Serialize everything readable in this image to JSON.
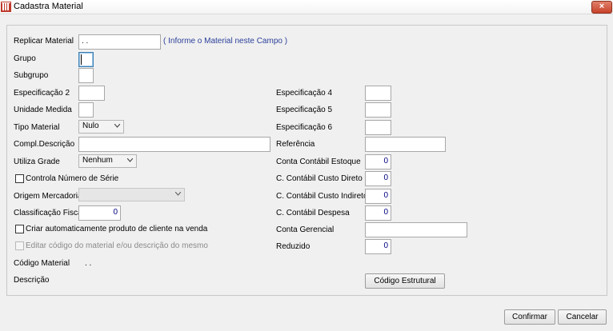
{
  "window": {
    "title": "Cadastra Material",
    "close_label": "×"
  },
  "left": {
    "replicar_label": "Replicar Material",
    "replicar_value": ".  .",
    "replicar_hint": "( Informe o Material neste Campo )",
    "grupo_label": "Grupo",
    "subgrupo_label": "Subgrupo",
    "espec2_label": "Especificação 2",
    "unidade_label": "Unidade Medida",
    "tipo_label": "Tipo Material",
    "tipo_value": "Nulo",
    "compl_label": "Compl.Descrição",
    "grade_label": "Utiliza Grade",
    "grade_value": "Nenhum",
    "serie_label": "Controla Número de Série",
    "origem_label": "Origem Mercadoria",
    "origem_value": "",
    "classif_label": "Classificação Fiscal",
    "classif_value": "0",
    "criar_label": "Criar automaticamente produto de cliente na venda",
    "editar_label": "Editar código do material e/ou descrição do mesmo",
    "codigo_label": "Código Material",
    "codigo_value": ".  .",
    "descricao_label": "Descrição"
  },
  "right": {
    "espec4_label": "Especificação 4",
    "espec5_label": "Especificação 5",
    "espec6_label": "Especificação 6",
    "referencia_label": "Referência",
    "conta_estoque_label": "Conta Contábil Estoque",
    "conta_estoque_value": "0",
    "custo_direto_label": "C. Contábil Custo Direto",
    "custo_direto_value": "0",
    "custo_indireto_label": "C. Contábil Custo Indireto",
    "custo_indireto_value": "0",
    "despesa_label": "C. Contábil Despesa",
    "despesa_value": "0",
    "gerencial_label": "Conta Gerencial",
    "reduzido_label": "Reduzido",
    "reduzido_value": "0",
    "codigo_estrutural_button": "Código Estrutural"
  },
  "footer": {
    "confirmar": "Confirmar",
    "cancelar": "Cancelar"
  },
  "colors": {
    "hint": "#2a3f9a",
    "numeric": "#000080",
    "close": "#c8432b"
  }
}
